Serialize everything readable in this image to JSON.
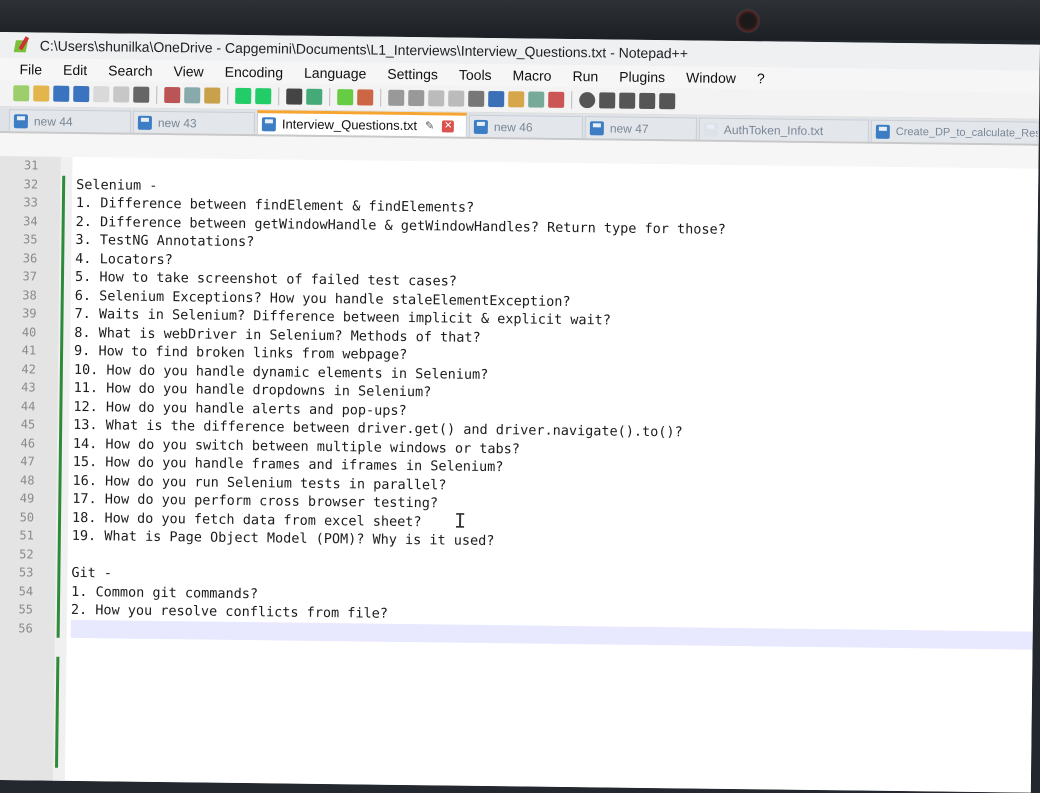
{
  "window": {
    "title": "C:\\Users\\shunilka\\OneDrive - Capgemini\\Documents\\L1_Interviews\\Interview_Questions.txt - Notepad++"
  },
  "menu": [
    "File",
    "Edit",
    "Search",
    "View",
    "Encoding",
    "Language",
    "Settings",
    "Tools",
    "Macro",
    "Run",
    "Plugins",
    "Window",
    "?"
  ],
  "tabs": [
    {
      "label": "new 44"
    },
    {
      "label": "new 43"
    },
    {
      "label": "Interview_Questions.txt"
    },
    {
      "label": "new 46"
    },
    {
      "label": "new 47"
    },
    {
      "label": "AuthToken_Info.txt"
    },
    {
      "label": "Create_DP_to_calculate_Res"
    }
  ],
  "editor": {
    "line_numbers": [
      "31",
      "32",
      "33",
      "34",
      "35",
      "36",
      "37",
      "38",
      "39",
      "40",
      "41",
      "42",
      "43",
      "44",
      "45",
      "46",
      "47",
      "48",
      "49",
      "50",
      "51",
      "52",
      "53",
      "54",
      "55",
      "56"
    ],
    "lines": [
      "",
      "Selenium -",
      "1. Difference between findElement & findElements?",
      "2. Difference between getWindowHandle & getWindowHandles? Return type for those?",
      "3. TestNG Annotations?",
      "4. Locators?",
      "5. How to take screenshot of failed test cases?",
      "6. Selenium Exceptions? How you handle staleElementException?",
      "7. Waits in Selenium? Difference between implicit & explicit wait?",
      "8. What is webDriver in Selenium? Methods of that?",
      "9. How to find broken links from webpage?",
      "10. How do you handle dynamic elements in Selenium?",
      "11. How do you handle dropdowns in Selenium?",
      "12. How do you handle alerts and pop-ups?",
      "13. What is the difference between driver.get() and driver.navigate().to()?",
      "14. How do you switch between multiple windows or tabs?",
      "15. How do you handle frames and iframes in Selenium?",
      "16. How do you run Selenium tests in parallel?",
      "17. How do you perform cross browser testing?",
      "18. How do you fetch data from excel sheet?",
      "19. What is Page Object Model (POM)? Why is it used?",
      "",
      "Git -",
      "1. Common git commands?",
      "2. How you resolve conflicts from file?",
      ""
    ]
  }
}
